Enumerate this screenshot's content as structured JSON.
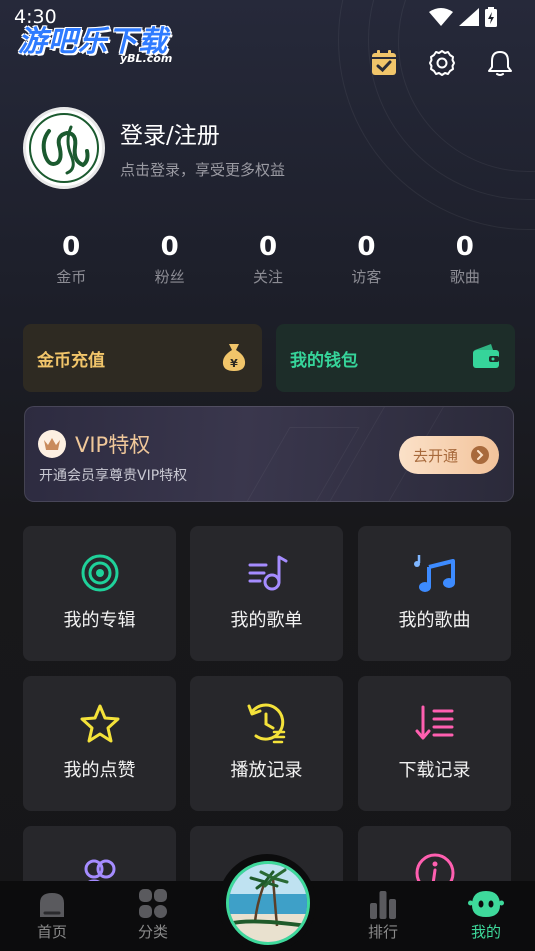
{
  "status_bar": {
    "time": "4:30"
  },
  "watermark": {
    "main": "游吧乐下载",
    "sub": "yBL.com"
  },
  "profile": {
    "title": "登录/注册",
    "subtitle": "点击登录，享受更多权益"
  },
  "stats": [
    {
      "value": "0",
      "label": "金币"
    },
    {
      "value": "0",
      "label": "粉丝"
    },
    {
      "value": "0",
      "label": "关注"
    },
    {
      "value": "0",
      "label": "访客"
    },
    {
      "value": "0",
      "label": "歌曲"
    }
  ],
  "wallet": {
    "recharge_label": "金币充值",
    "wallet_label": "我的钱包"
  },
  "vip": {
    "title": "VIP特权",
    "subtitle": "开通会员享尊贵VIP特权",
    "button": "去开通"
  },
  "grid": [
    {
      "label": "我的专辑",
      "icon": "album-icon"
    },
    {
      "label": "我的歌单",
      "icon": "playlist-icon"
    },
    {
      "label": "我的歌曲",
      "icon": "music-note-icon"
    },
    {
      "label": "我的点赞",
      "icon": "star-icon"
    },
    {
      "label": "播放记录",
      "icon": "history-icon"
    },
    {
      "label": "下载记录",
      "icon": "download-list-icon"
    },
    {
      "label": "",
      "icon": "users-icon"
    },
    {
      "label": "",
      "icon": "blank"
    },
    {
      "label": "",
      "icon": "info-icon"
    }
  ],
  "tabbar": {
    "home": "首页",
    "category": "分类",
    "rank": "排行",
    "mine": "我的"
  },
  "colors": {
    "accent_green": "#3ed99b",
    "gold": "#f1c56a",
    "vip_text": "#f0c89a",
    "tile_bg": "#27272b"
  }
}
